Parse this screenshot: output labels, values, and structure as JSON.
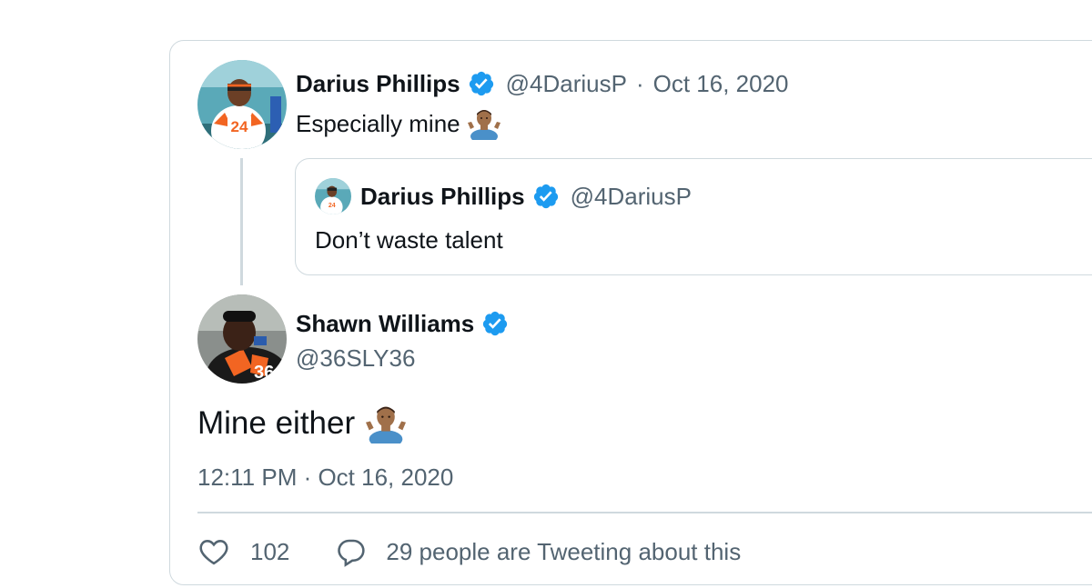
{
  "parent_tweet": {
    "name": "Darius Phillips",
    "handle": "@4DariusP",
    "separator": "·",
    "date": "Oct 16, 2020",
    "text": "Especially mine",
    "emoji": "person-shrugging"
  },
  "quoted_tweet": {
    "name": "Darius Phillips",
    "handle": "@4DariusP",
    "text": "Don’t waste talent"
  },
  "main_tweet": {
    "name": "Shawn Williams",
    "handle": "@36SLY36",
    "text": "Mine either",
    "emoji": "person-shrugging",
    "timestamp": "12:11 PM · Oct 16, 2020"
  },
  "actions": {
    "like_count": "102",
    "reply_text": "29 people are Tweeting about this"
  },
  "colors": {
    "verified": "#1d9bf0",
    "muted": "#536471",
    "border": "#cfd9de"
  }
}
